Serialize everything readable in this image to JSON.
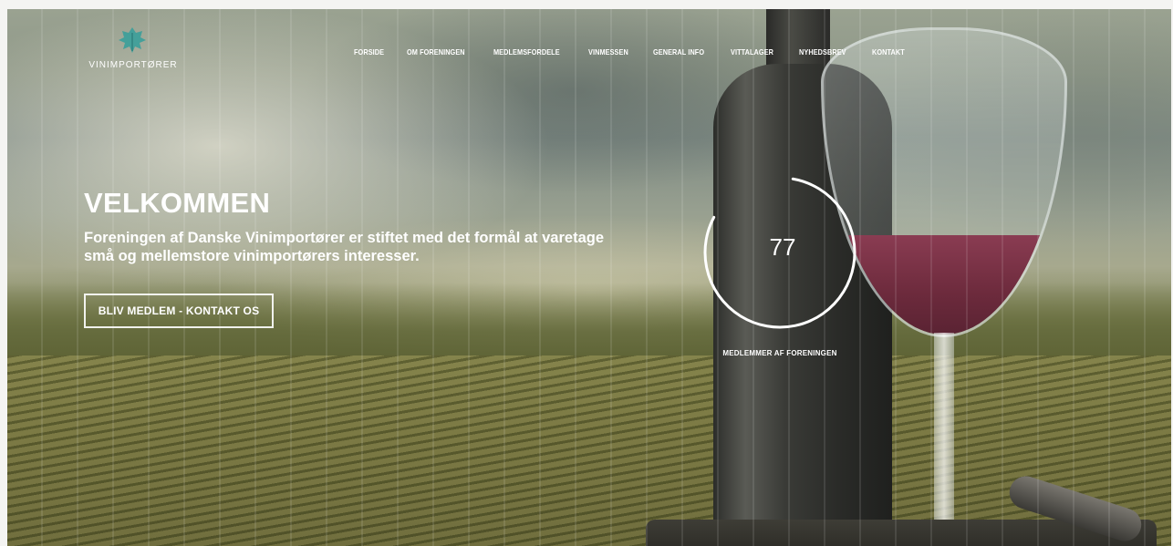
{
  "header": {
    "logo_text": "VINIMPORTØRER",
    "logo_icon": "grape-leaf-icon"
  },
  "nav": {
    "items": [
      {
        "label": "FORSIDE",
        "active": true
      },
      {
        "label": "OM FORENINGEN",
        "active": false
      },
      {
        "label": "MEDLEMSFORDELE",
        "active": false
      },
      {
        "label": "VINMESSEN",
        "active": false
      },
      {
        "label": "GENERAL INFO",
        "active": false
      },
      {
        "label": "VITTALAGER",
        "active": false
      },
      {
        "label": "NYHEDSBREV",
        "active": false
      },
      {
        "label": "KONTAKT",
        "active": false
      }
    ]
  },
  "hero": {
    "title": "VELKOMMEN",
    "text": "Foreningen af Danske Vinimportører er stiftet med det formål at varetage små og mellemstore vinimportørers interesser.",
    "cta_label": "BLIV MEDLEM - KONTAKT OS"
  },
  "counter": {
    "value": "77",
    "label": "MEDLEMMER AF FORENINGEN",
    "ring_fraction": 0.8
  },
  "colors": {
    "text": "#ffffff",
    "logo_accent": "#3a9e9a",
    "wine": "#7a3148"
  }
}
